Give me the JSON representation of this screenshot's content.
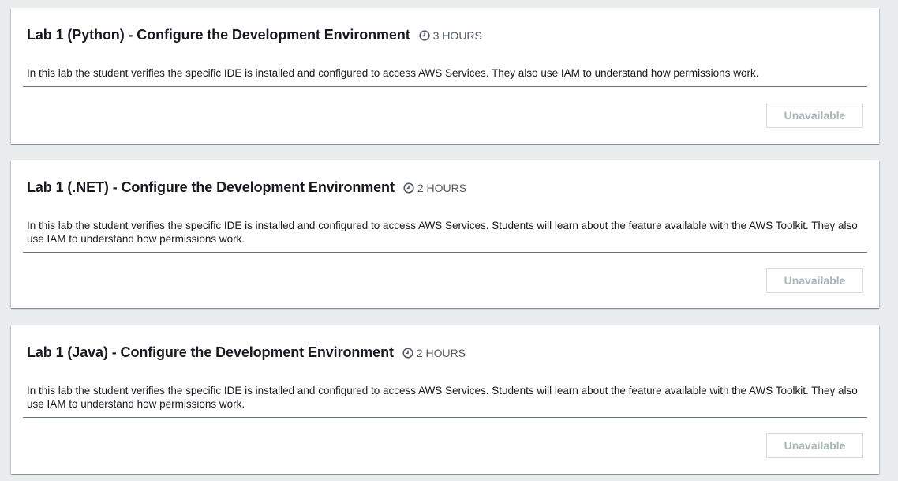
{
  "labs": [
    {
      "title": "Lab 1 (Python) - Configure the Development Environment",
      "duration": "3 HOURS",
      "description": "In this lab the student verifies the specific IDE is installed and configured to access AWS Services. They also use IAM to understand how permissions work.",
      "button_label": "Unavailable"
    },
    {
      "title": "Lab 1 (.NET) - Configure the Development Environment",
      "duration": "2 HOURS",
      "description": "In this lab the student verifies the specific IDE is installed and configured to access AWS Services. Students will learn about the feature available with the AWS Toolkit. They also use IAM to understand how permissions work.",
      "button_label": "Unavailable"
    },
    {
      "title": "Lab 1 (Java) - Configure the Development Environment",
      "duration": "2 HOURS",
      "description": "In this lab the student verifies the specific IDE is installed and configured to access AWS Services. Students will learn about the feature available with the AWS Toolkit. They also use IAM to understand how permissions work.",
      "button_label": "Unavailable"
    }
  ],
  "icons": {
    "duration": "clock-icon"
  },
  "colors": {
    "page_background": "#eaeded",
    "card_background": "#ffffff",
    "disabled_button_text": "#aab7b8",
    "duration_text": "#545b64"
  }
}
